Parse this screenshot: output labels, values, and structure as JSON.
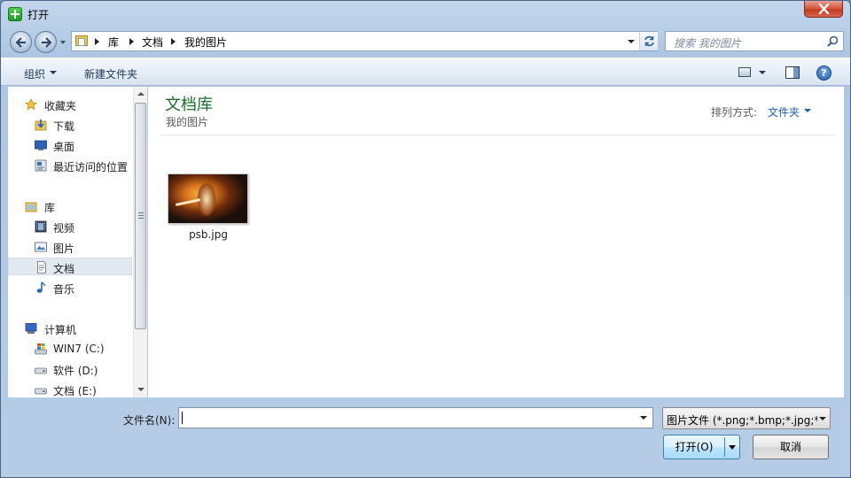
{
  "window": {
    "title": "打开",
    "close_symbol": "✕"
  },
  "address": {
    "crumbs": [
      "库",
      "文档",
      "我的图片"
    ],
    "search_placeholder": "搜索 我的图片"
  },
  "toolbar": {
    "organize_label": "组织",
    "new_folder_label": "新建文件夹",
    "help_symbol": "?"
  },
  "nav": {
    "favorites_label": "收藏夹",
    "downloads_label": "下载",
    "desktop_label": "桌面",
    "recent_label": "最近访问的位置",
    "libraries_label": "库",
    "videos_label": "视频",
    "pictures_label": "图片",
    "documents_label": "文档",
    "music_label": "音乐",
    "computer_label": "计算机",
    "drive_c_label": "WIN7 (C:)",
    "drive_d_label": "软件 (D:)",
    "drive_e_label": "文档 (E:)"
  },
  "content": {
    "library_title": "文档库",
    "library_subtitle": "我的图片",
    "sort_label": "排列方式:",
    "sort_value": "文件夹",
    "files": [
      {
        "name": "psb.jpg"
      }
    ]
  },
  "bottom": {
    "filename_label": "文件名(N):",
    "filename_value": "",
    "filter_text": "图片文件 (*.png;*.bmp;*.jpg;*",
    "open_label": "打开(O)",
    "cancel_label": "取消"
  },
  "colors": {
    "library_title": "#1e6b2b",
    "link_blue": "#1e5faa",
    "selection": "#e3e9f1"
  }
}
